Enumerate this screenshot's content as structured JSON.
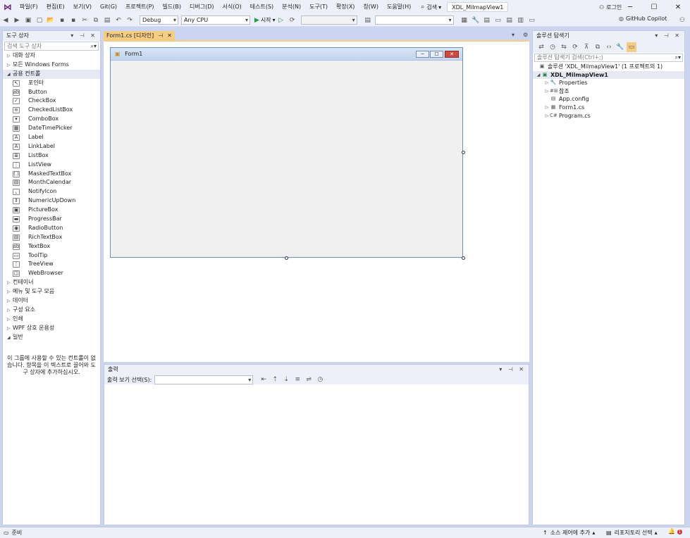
{
  "menu": [
    "파일(F)",
    "편집(E)",
    "보기(V)",
    "Git(G)",
    "프로젝트(P)",
    "빌드(B)",
    "디버그(D)",
    "서식(O)",
    "테스트(S)",
    "분석(N)",
    "도구(T)",
    "확장(X)",
    "창(W)",
    "도움말(H)"
  ],
  "search_label": "검색",
  "solution_name": "XDL_MilmapView1",
  "login": "로그인",
  "toolbar": {
    "config": "Debug",
    "platform": "Any CPU",
    "start": "시작",
    "copilot": "GitHub Copilot"
  },
  "toolbox": {
    "title": "도구 상자",
    "search_placeholder": "검색 도구 상자",
    "groups_top": [
      "대화 상자",
      "모든 Windows Forms"
    ],
    "common_group": "공용 컨트롤",
    "items": [
      {
        "label": "포인터",
        "icon": "pointer-icon",
        "glyph": "↖"
      },
      {
        "label": "Button",
        "icon": "button-icon",
        "glyph": "ab"
      },
      {
        "label": "CheckBox",
        "icon": "checkbox-icon",
        "glyph": "✓"
      },
      {
        "label": "CheckedListBox",
        "icon": "checkedlistbox-icon",
        "glyph": "≡"
      },
      {
        "label": "ComboBox",
        "icon": "combobox-icon",
        "glyph": "▾"
      },
      {
        "label": "DateTimePicker",
        "icon": "datetimepicker-icon",
        "glyph": "▦"
      },
      {
        "label": "Label",
        "icon": "label-icon",
        "glyph": "A"
      },
      {
        "label": "LinkLabel",
        "icon": "linklabel-icon",
        "glyph": "A"
      },
      {
        "label": "ListBox",
        "icon": "listbox-icon",
        "glyph": "≣"
      },
      {
        "label": "ListView",
        "icon": "listview-icon",
        "glyph": "⋮"
      },
      {
        "label": "MaskedTextBox",
        "icon": "maskedtextbox-icon",
        "glyph": "(.)"
      },
      {
        "label": "MonthCalendar",
        "icon": "monthcalendar-icon",
        "glyph": "▤"
      },
      {
        "label": "NotifyIcon",
        "icon": "notifyicon-icon",
        "glyph": "⌞"
      },
      {
        "label": "NumericUpDown",
        "icon": "numericupdown-icon",
        "glyph": "⇕"
      },
      {
        "label": "PictureBox",
        "icon": "picturebox-icon",
        "glyph": "▣"
      },
      {
        "label": "ProgressBar",
        "icon": "progressbar-icon",
        "glyph": "▬"
      },
      {
        "label": "RadioButton",
        "icon": "radiobutton-icon",
        "glyph": "◉"
      },
      {
        "label": "RichTextBox",
        "icon": "richtextbox-icon",
        "glyph": "▤"
      },
      {
        "label": "TextBox",
        "icon": "textbox-icon",
        "glyph": "ab"
      },
      {
        "label": "ToolTip",
        "icon": "tooltip-icon",
        "glyph": "▭"
      },
      {
        "label": "TreeView",
        "icon": "treeview-icon",
        "glyph": "⋮"
      },
      {
        "label": "WebBrowser",
        "icon": "webbrowser-icon",
        "glyph": "◫"
      }
    ],
    "groups_bottom": [
      "컨테이너",
      "메뉴 및 도구 모음",
      "데이터",
      "구성 요소",
      "인쇄",
      "WPF 상호 운용성"
    ],
    "general_group": "일반",
    "general_msg": "이 그룹에 사용할 수 있는 컨트롤이 없습니다. 항목을 이 텍스트로 끌어와 도구 상자에 추가하십시오."
  },
  "doc_tab": {
    "label": "Form1.cs [디자인]",
    "pin": "ㅁ",
    "close": "✕"
  },
  "form": {
    "caption": "Form1"
  },
  "output": {
    "title": "출력",
    "source_label": "출력 보기 선택(S):"
  },
  "solution_explorer": {
    "title": "솔루션 탐색기",
    "search_placeholder": "솔루션 탐색기 검색(Ctrl+;)",
    "root": "솔루션 'XDL_MilmapView1' (1 프로젝트의 1)",
    "project": "XDL_MilmapView1",
    "nodes": [
      {
        "label": "Properties",
        "icon": "wrench-icon",
        "glyph": "🔧",
        "arrow": true
      },
      {
        "label": "참조",
        "icon": "references-icon",
        "glyph": "#⊞",
        "arrow": true
      },
      {
        "label": "App.config",
        "icon": "config-file-icon",
        "glyph": "▤",
        "arrow": false
      },
      {
        "label": "Form1.cs",
        "icon": "form-file-icon",
        "glyph": "▦",
        "arrow": true
      },
      {
        "label": "Program.cs",
        "icon": "csharp-file-icon",
        "glyph": "C#",
        "arrow": true
      }
    ]
  },
  "status": {
    "ready": "준비",
    "source_control": "소스 제어에 추가",
    "repository": "리포지토리 선택",
    "notification_count": "1"
  }
}
